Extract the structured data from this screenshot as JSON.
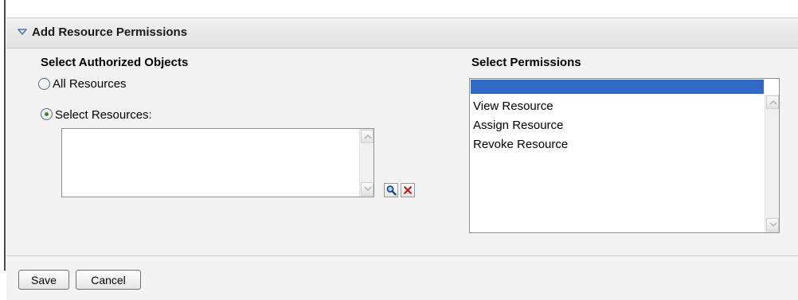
{
  "panel": {
    "title": "Add Resource Permissions"
  },
  "authorized_objects": {
    "heading": "Select Authorized Objects",
    "options": [
      {
        "label": "All Resources",
        "selected": false
      },
      {
        "label": "Select Resources:",
        "selected": true
      }
    ],
    "resources_list": []
  },
  "permissions": {
    "heading": "Select Permissions",
    "options": [
      {
        "label": "",
        "selected": true
      },
      {
        "label": "View Resource",
        "selected": false
      },
      {
        "label": "Assign Resource",
        "selected": false
      },
      {
        "label": "Revoke Resource",
        "selected": false
      }
    ]
  },
  "toolbar": {
    "search_icon": "magnifier-icon",
    "remove_icon": "red-x-icon"
  },
  "footer": {
    "save_label": "Save",
    "cancel_label": "Cancel"
  },
  "colors": {
    "selection": "#3169c6",
    "panel_background": "#f3f3f3",
    "header_background": "#e8e8e8",
    "radio_dot": "#2d8a2d",
    "remove_icon": "#d01010"
  }
}
